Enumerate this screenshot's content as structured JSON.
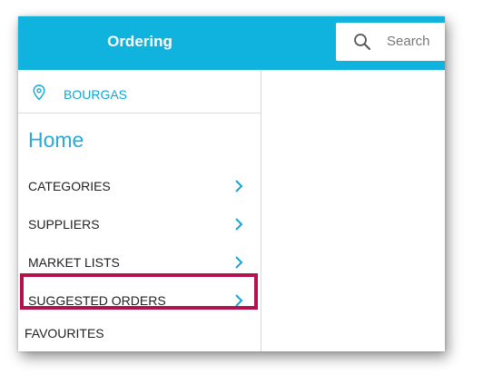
{
  "header": {
    "title": "Ordering",
    "search_placeholder": "Search"
  },
  "sidebar": {
    "location": "BOURGAS",
    "heading": "Home",
    "items": [
      {
        "label": "CATEGORIES"
      },
      {
        "label": "SUPPLIERS"
      },
      {
        "label": "MARKET LISTS"
      },
      {
        "label": "SUGGESTED ORDERS"
      },
      {
        "label": "FAVOURITES"
      }
    ]
  },
  "colors": {
    "accent": "#0fb3dd",
    "highlight": "#b3124e"
  },
  "icons": {
    "search": "search-icon",
    "location": "location-pin-icon",
    "chevron": "chevron-right-icon"
  }
}
